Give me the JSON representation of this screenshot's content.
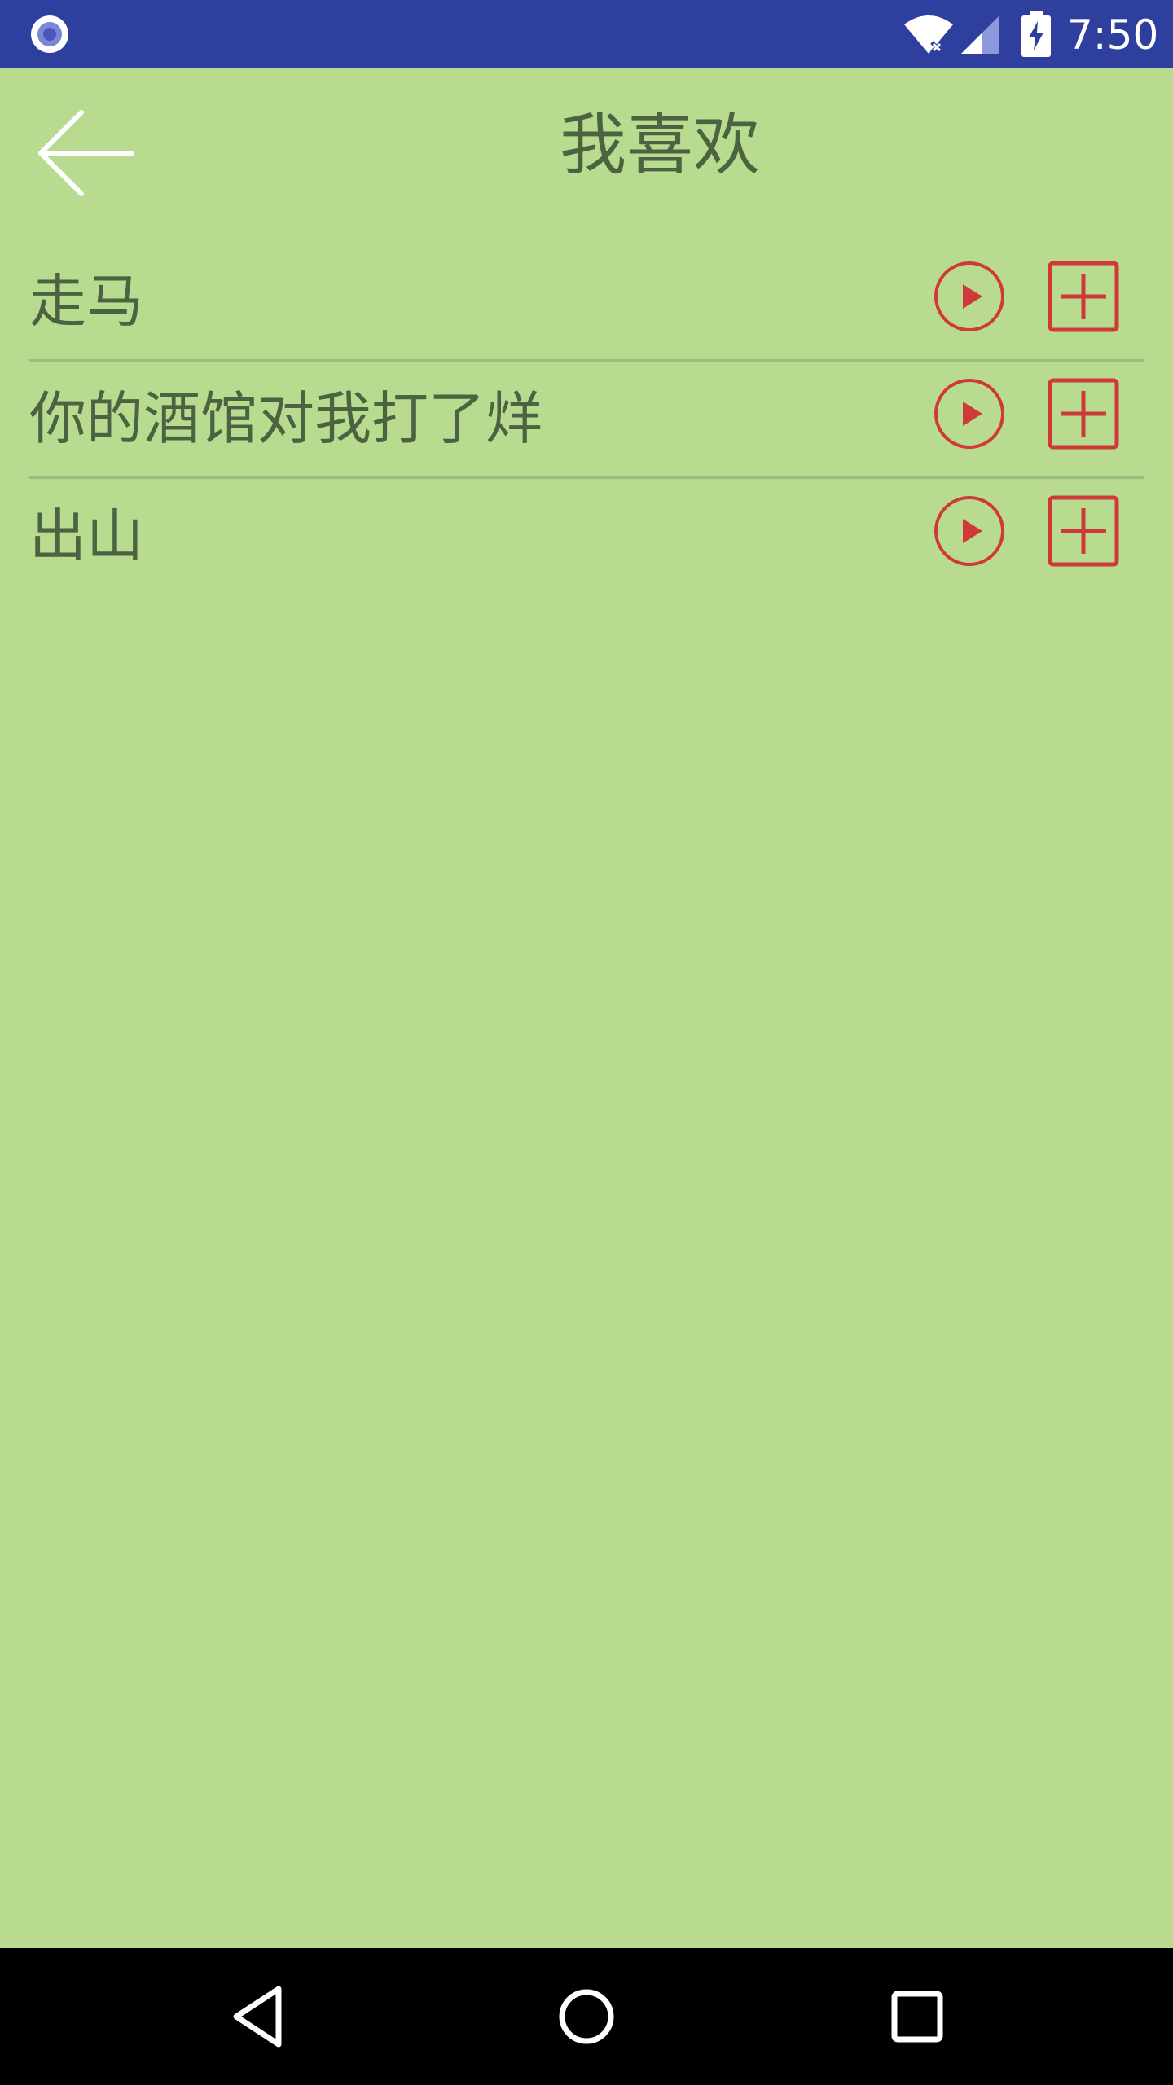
{
  "status_bar": {
    "time": "7:50",
    "icons": [
      "notification-dot-icon",
      "wifi-off-icon",
      "signal-icon",
      "battery-charging-icon"
    ],
    "colors": {
      "background": "#2f3f9e",
      "foreground": "#ffffff"
    }
  },
  "app_bar": {
    "title": "我喜欢",
    "back_icon": "arrow-left-icon"
  },
  "list": {
    "items": [
      {
        "title": "走马",
        "play_icon": "play-circle-icon",
        "add_icon": "plus-square-icon"
      },
      {
        "title": "你的酒馆对我打了烊",
        "play_icon": "play-circle-icon",
        "add_icon": "plus-square-icon"
      },
      {
        "title": "出山",
        "play_icon": "play-circle-icon",
        "add_icon": "plus-square-icon"
      }
    ]
  },
  "navigation_bar": {
    "icons": [
      "nav-back-icon",
      "nav-home-icon",
      "nav-recents-icon"
    ]
  },
  "colors": {
    "background": "#b8db8f",
    "text": "#4a6340",
    "accent": "#d0393a",
    "divider": "#9cbc7e"
  }
}
